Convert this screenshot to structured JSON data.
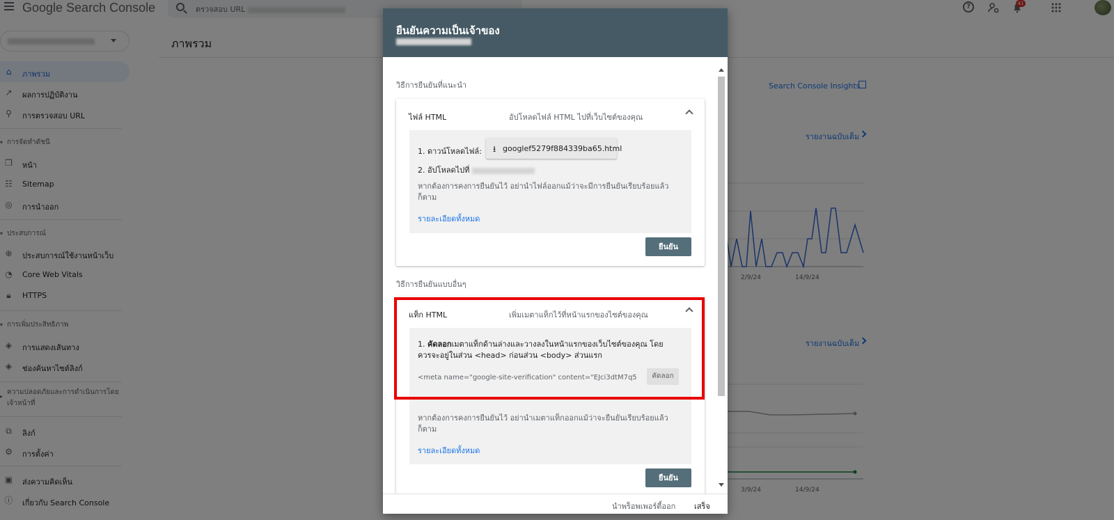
{
  "header": {
    "app_name": "Google Search Console",
    "search_placeholder": "ตรวจสอบ URL",
    "notification_count": "41"
  },
  "page": {
    "title": "ภาพรวม"
  },
  "sidebar": {
    "items": [
      {
        "label": "ภาพรวม",
        "icon": "home-icon"
      },
      {
        "label": "ผลการปฏิบัติงาน",
        "icon": "trending-up-icon"
      },
      {
        "label": "การตรวจสอบ URL",
        "icon": "search-icon"
      }
    ],
    "indexing_section": "การจัดทำดัชนี",
    "indexing_items": [
      {
        "label": "หน้า",
        "icon": "pages-icon"
      },
      {
        "label": "Sitemap",
        "icon": "sitemap-icon"
      },
      {
        "label": "การนำออก",
        "icon": "removals-icon"
      }
    ],
    "experience_section": "ประสบการณ์",
    "experience_items": [
      {
        "label": "ประสบการณ์ใช้งานหน้าเว็บ",
        "icon": "page-experience-icon"
      },
      {
        "label": "Core Web Vitals",
        "icon": "gauge-icon"
      },
      {
        "label": "HTTPS",
        "icon": "lock-icon"
      }
    ],
    "enhancements_section": "การเพิ่มประสิทธิภาพ",
    "enhancements_items": [
      {
        "label": "การแสดงเส้นทาง",
        "icon": "breadcrumbs-icon"
      },
      {
        "label": "ช่องค้นหาไซต์ลิงก์",
        "icon": "sitelinks-icon"
      }
    ],
    "security_section": "ความปลอดภัยและการดำเนินการโดยเจ้าหน้าที่",
    "bottom_items": [
      {
        "label": "ลิงก์",
        "icon": "links-icon"
      },
      {
        "label": "การตั้งค่า",
        "icon": "settings-icon"
      }
    ],
    "footer_items": [
      {
        "label": "ส่งความคิดเห็น",
        "icon": "feedback-icon"
      },
      {
        "label": "เกี่ยวกับ Search Console",
        "icon": "info-icon"
      }
    ]
  },
  "background": {
    "insights_link": "Search Console Insights",
    "full_report_1": "รายงานฉบับเต็ม",
    "full_report_2": "รายงานฉบับเต็ม",
    "chart1_dates": [
      "2/9/24",
      "14/9/24"
    ],
    "chart2_dates": [
      "3/9/24",
      "14/9/24"
    ]
  },
  "dialog": {
    "title": "ยืนยันความเป็นเจ้าของ",
    "recommended_label": "วิธีการยืนยันที่แนะนำ",
    "other_label": "วิธีการยืนยันแบบอื่นๆ",
    "html_file": {
      "title": "ไฟล์ HTML",
      "description": "อัปโหลดไฟล์ HTML ไปที่เว็บไซต์ของคุณ",
      "step1_label": "1. ดาวน์โหลดไฟล์:",
      "download_file": "googlef5279f884339ba65.html",
      "step2_label": "2. อัปโหลดไปที่",
      "note": "หากต้องการคงการยืนยันไว้ อย่านำไฟล์ออกแม้ว่าจะมีการยืนยันเรียบร้อยแล้วก็ตาม",
      "details_link": "รายละเอียดทั้งหมด",
      "confirm_button": "ยืนยัน"
    },
    "html_tag": {
      "title": "แท็ก HTML",
      "description": "เพิ่มเมตาแท็กไว้ที่หน้าแรกของไซต์ของคุณ",
      "step1_prefix": "1. ",
      "step1_bold": "คัดลอก",
      "step1_rest": "เมตาแท็กด้านล่างและวางลงในหน้าแรกของเว็บไซต์ของคุณ โดยควรจะอยู่ในส่วน <head> ก่อนส่วน <body> ส่วนแรก",
      "meta_tag": "<meta name=\"google-site-verification\" content=\"EJci3dtM7q5",
      "copy_button": "คัดลอก",
      "note": "หากต้องการคงการยืนยันไว้ อย่านำเมตาแท็กออกแม้ว่าจะยืนยันเรียบร้อยแล้วก็ตาม",
      "details_link": "รายละเอียดทั้งหมด",
      "confirm_button": "ยืนยัน"
    },
    "footer": {
      "remove_property": "นำพร็อพเพอร์ตี้ออก",
      "done": "เสร็จ"
    }
  },
  "colors": {
    "dialog_header": "#455a64",
    "confirm_button": "#546e7a",
    "link": "#1a73e8",
    "highlight_box": "#e80000",
    "chart_line": "#3367d6"
  }
}
